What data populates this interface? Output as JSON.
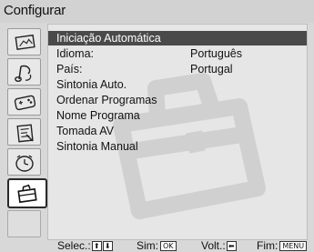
{
  "title": "Configurar",
  "sidebar": {
    "icons": [
      {
        "name": "picture-icon"
      },
      {
        "name": "sound-icon"
      },
      {
        "name": "features-icon"
      },
      {
        "name": "settings-icon"
      },
      {
        "name": "timer-icon"
      },
      {
        "name": "setup-toolbox-icon",
        "selected": true
      },
      {
        "name": "empty-slot"
      }
    ]
  },
  "menu": {
    "items": [
      {
        "label": "Iniciação Automática",
        "selected": true
      },
      {
        "label": "Idioma:",
        "value": "Português"
      },
      {
        "label": "País:",
        "value": "Portugal"
      },
      {
        "label": "Sintonia Auto."
      },
      {
        "label": "Ordenar Programas"
      },
      {
        "label": "Nome Programa"
      },
      {
        "label": "Tomada AV"
      },
      {
        "label": "Sintonia Manual"
      }
    ]
  },
  "footer": {
    "select_label": "Selec.:",
    "select_up": "⬆",
    "select_down": "⬇",
    "confirm_label": "Sim:",
    "confirm_key": "OK",
    "back_label": "Volt.:",
    "back_key": "⬅",
    "exit_label": "Fim:",
    "exit_key": "MENU"
  },
  "colors": {
    "background": "#d8d8d8",
    "panel": "#e6e6e6",
    "highlight": "#4a4a4a"
  }
}
